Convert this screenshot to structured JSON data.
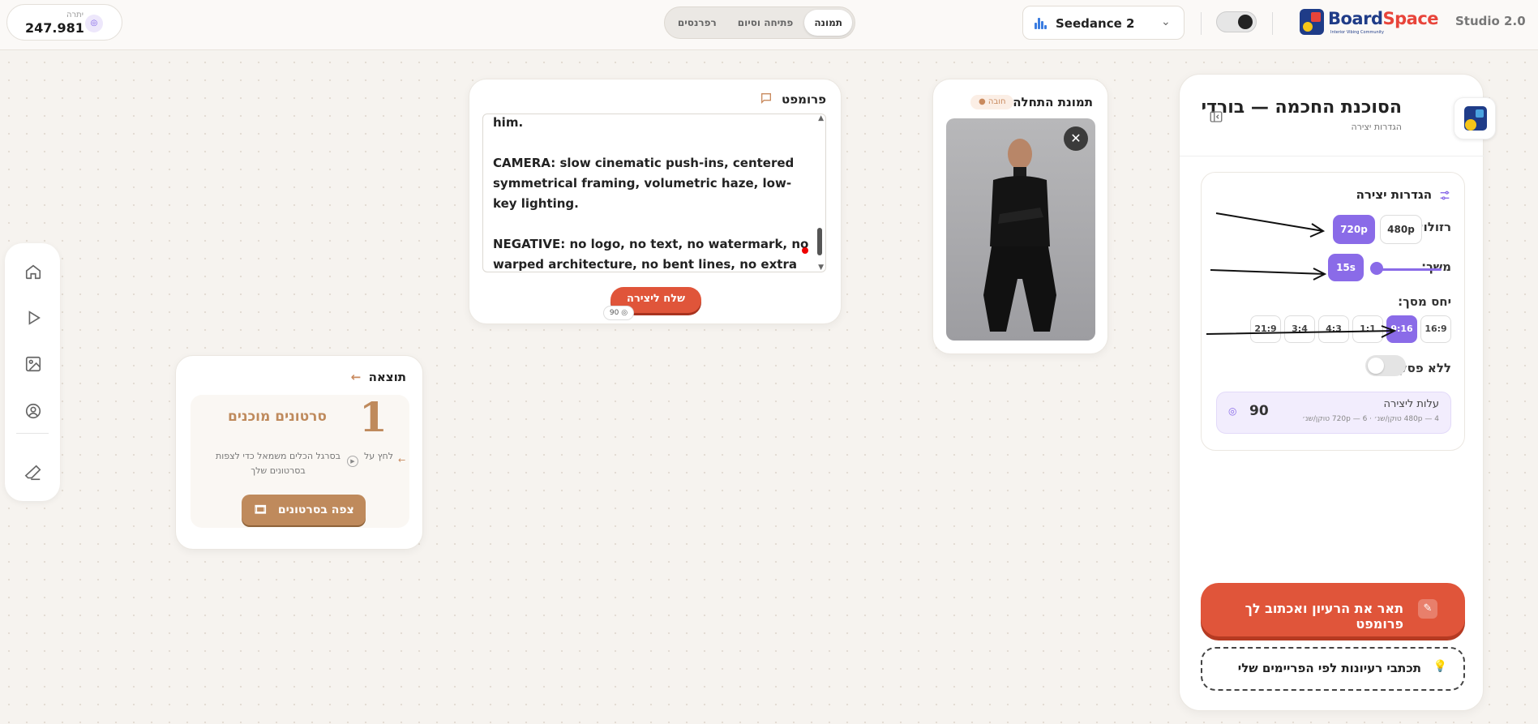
{
  "header": {
    "credit_label": "יתרה",
    "credit_value": "247.981",
    "tabs": [
      "תמונה",
      "פתיחה וסיום",
      "רפרנסים"
    ],
    "model_name": "Seedance 2",
    "logo_text_a": "Board",
    "logo_text_b": "Space",
    "logo_sub": "Interior Vibing Community",
    "studio_label": "Studio 2.0"
  },
  "prompt_card": {
    "title": "פרומפט",
    "text": "him.\n\nCAMERA: slow cinematic push-ins, centered symmetrical framing, volumetric haze, low-key lighting.\n\nNEGATIVE: no logo, no text, no watermark, no warped architecture, no bent lines, no extra fingers, no fisheye.",
    "send_label": "שלח ליצירה",
    "send_cost": "90"
  },
  "start_image_card": {
    "title": "תמונת התחלה",
    "required_badge": "חובה"
  },
  "result_card": {
    "title": "תוצאה",
    "count": "1",
    "ready_label": "סרטונים מוכנים",
    "hint_a": "לחץ על",
    "hint_b": "בסרגל הכלים משמאל כדי לצפות בסרטונים שלך",
    "watch_label": "צפה בסרטונים"
  },
  "side_panel": {
    "agent_title": "הסוכנת החכמה — בורדי",
    "agent_subtitle": "הגדרות יצירה",
    "settings_title": "הגדרות יצירה",
    "resolution_label": "רזולוציה:",
    "resolutions": [
      "720p",
      "480p"
    ],
    "selected_resolution": "720p",
    "duration_label": "משך:",
    "duration_value": "15s",
    "duration_fraction": 0.0,
    "ratio_label": "יחס מסך:",
    "ratios": [
      "16:9",
      "9:16",
      "1:1",
      "4:3",
      "3:4",
      "21:9"
    ],
    "selected_ratio": "9:16",
    "no_audio_label": "ללא פסקול:",
    "cost_title": "עלות ליצירה",
    "cost_detail": "4 — 480p טוקן/שנ׳ · 6 — 720p טוקן/שנ׳",
    "cost_value": "90",
    "describe_label": "תאר את הרעיון ואכתוב לך פרומפט",
    "ideas_label": "תכתבי רעיונות לפי הפריימים שלי"
  },
  "colors": {
    "accent": "#8a6be8",
    "primary_button": "#e0553a",
    "result_brown": "#bf8a5c"
  }
}
